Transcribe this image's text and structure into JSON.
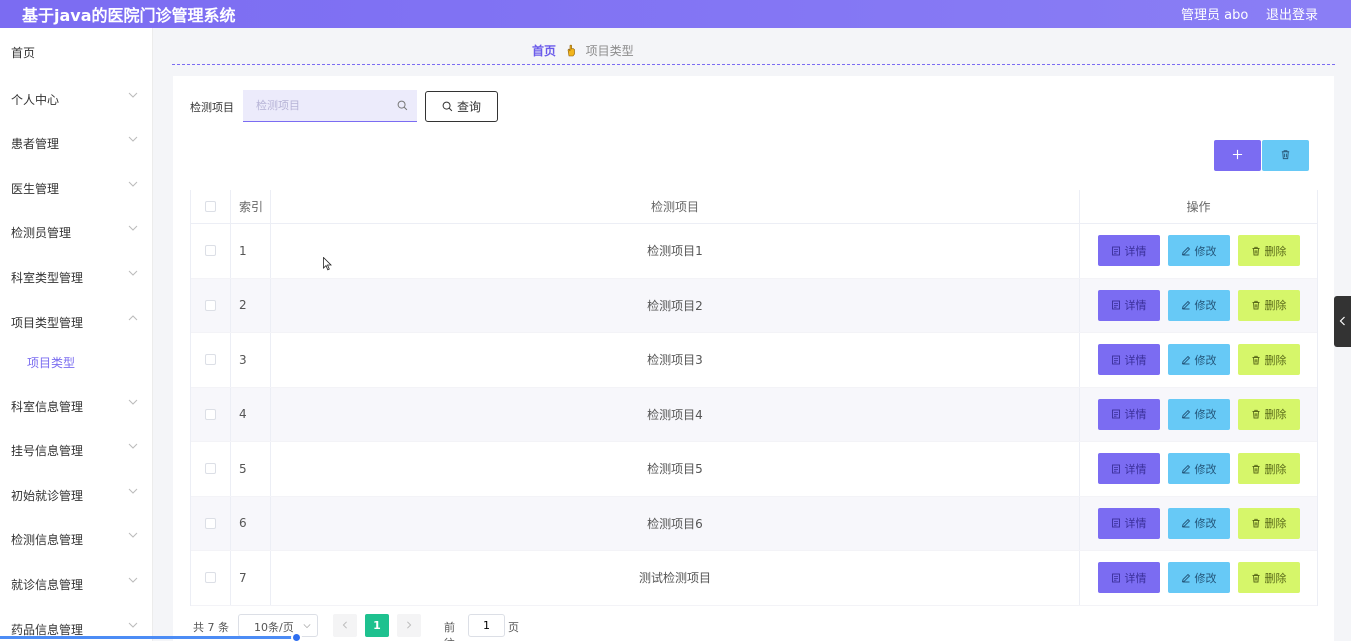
{
  "header": {
    "title": "基于java的医院门诊管理系统",
    "user": "管理员 abo",
    "logout": "退出登录"
  },
  "sidebar": {
    "items": [
      {
        "label": "首页",
        "has_arrow": false
      },
      {
        "label": "个人中心",
        "has_arrow": true
      },
      {
        "label": "患者管理",
        "has_arrow": true
      },
      {
        "label": "医生管理",
        "has_arrow": true
      },
      {
        "label": "检测员管理",
        "has_arrow": true
      },
      {
        "label": "科室类型管理",
        "has_arrow": true
      },
      {
        "label": "项目类型管理",
        "has_arrow": true,
        "expanded": true
      },
      {
        "label": "项目类型",
        "sub": true
      },
      {
        "label": "科室信息管理",
        "has_arrow": true
      },
      {
        "label": "挂号信息管理",
        "has_arrow": true
      },
      {
        "label": "初始就诊管理",
        "has_arrow": true
      },
      {
        "label": "检测信息管理",
        "has_arrow": true
      },
      {
        "label": "就诊信息管理",
        "has_arrow": true
      },
      {
        "label": "药品信息管理",
        "has_arrow": true
      }
    ]
  },
  "breadcrumb": {
    "home": "首页",
    "current": "项目类型"
  },
  "search": {
    "label": "检测项目",
    "placeholder": "检测项目",
    "value": "",
    "button": "查询"
  },
  "toolbar": {
    "add_icon": "plus-icon",
    "delete_icon": "trash-icon"
  },
  "table": {
    "headers": {
      "index": "索引",
      "name": "检测项目",
      "actions": "操作"
    },
    "rows": [
      {
        "index": "1",
        "name": "检测项目1"
      },
      {
        "index": "2",
        "name": "检测项目2"
      },
      {
        "index": "3",
        "name": "检测项目3"
      },
      {
        "index": "4",
        "name": "检测项目4"
      },
      {
        "index": "5",
        "name": "检测项目5"
      },
      {
        "index": "6",
        "name": "检测项目6"
      },
      {
        "index": "7",
        "name": "测试检测项目"
      }
    ],
    "actions": {
      "detail": "详情",
      "edit": "修改",
      "delete": "删除"
    }
  },
  "pagination": {
    "total": "共 7 条",
    "page_size": "10条/页",
    "current": "1",
    "goto_label": "前往",
    "goto_value": "1",
    "page_label": "页"
  },
  "colors": {
    "header": "#7b6cf2",
    "accent": "#7b6cf2",
    "detail_btn": "#7b6cf2",
    "edit_btn": "#67c9f6",
    "delete_btn": "#d6f66a",
    "pager_active": "#1ec18f"
  }
}
